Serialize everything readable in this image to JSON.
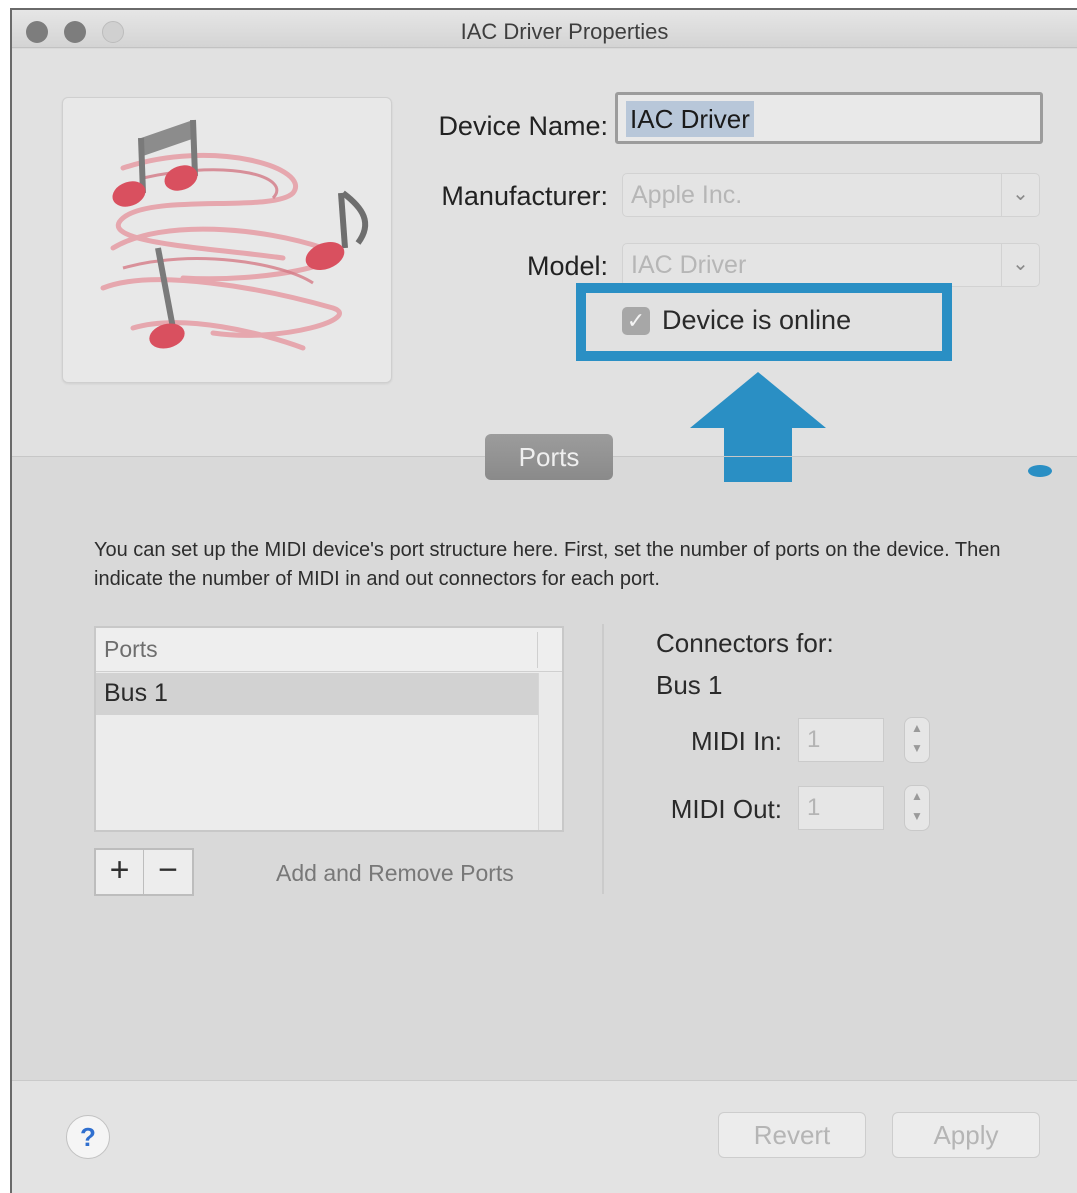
{
  "window": {
    "title": "IAC Driver Properties"
  },
  "device": {
    "name_label": "Device Name:",
    "name_value": "IAC Driver",
    "manufacturer_label": "Manufacturer:",
    "manufacturer_value": "Apple Inc.",
    "model_label": "Model:",
    "model_value": "IAC Driver",
    "online_label": "Device is online",
    "online_checked": true,
    "highlight_color": "#2a8fc4"
  },
  "tabs": {
    "ports": "Ports"
  },
  "ports_pane": {
    "description": "You can set up the MIDI device's port structure here. First, set the number of ports on the device. Then indicate the number of MIDI in and out connectors for each port.",
    "table_header": "Ports",
    "rows": [
      "Bus 1"
    ],
    "plus": "+",
    "minus": "−",
    "add_remove_label": "Add and Remove Ports",
    "connectors_title": "Connectors for:",
    "selected_port": "Bus 1",
    "midi_in_label": "MIDI In:",
    "midi_in_value": "1",
    "midi_out_label": "MIDI Out:",
    "midi_out_value": "1"
  },
  "footer": {
    "help": "?",
    "revert": "Revert",
    "apply": "Apply"
  },
  "icons": [
    "music-notes-icon",
    "checkmark-icon",
    "chevron-down-icon",
    "up-arrow-icon",
    "stepper-icon",
    "help-icon"
  ]
}
